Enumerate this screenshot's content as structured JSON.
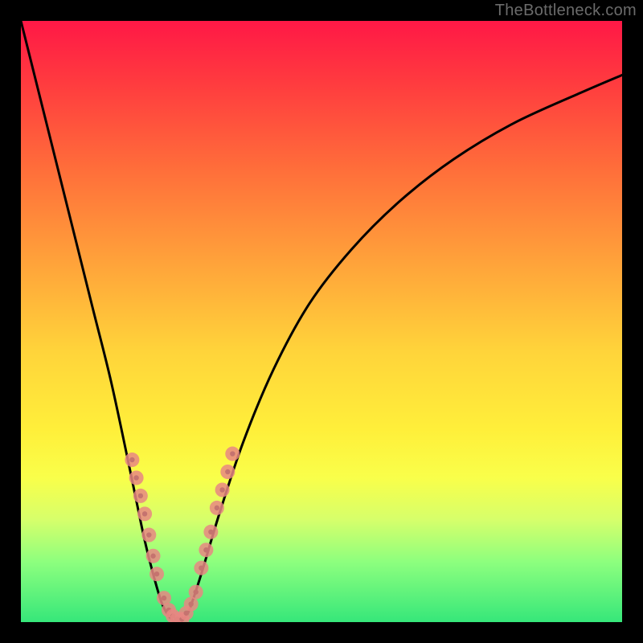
{
  "watermark": "TheBottleneck.com",
  "chart_data": {
    "type": "line",
    "title": "",
    "xlabel": "",
    "ylabel": "",
    "xlim": [
      0,
      100
    ],
    "ylim": [
      0,
      100
    ],
    "series": [
      {
        "name": "bottleneck-curve",
        "x": [
          0,
          3,
          6,
          9,
          12,
          15,
          18,
          20.5,
          22,
          23.5,
          25,
          26,
          27,
          28,
          30,
          33,
          37,
          42,
          48,
          55,
          63,
          72,
          82,
          93,
          100
        ],
        "y": [
          100,
          88,
          76,
          64,
          52,
          40,
          26,
          14,
          8,
          3,
          0.5,
          0,
          0.5,
          2,
          8,
          18,
          30,
          42,
          53,
          62,
          70,
          77,
          83,
          88,
          91
        ]
      }
    ],
    "markers": {
      "name": "highlight-cluster",
      "color": "#e88783",
      "points": [
        {
          "x": 18.5,
          "y": 27
        },
        {
          "x": 19.2,
          "y": 24
        },
        {
          "x": 19.9,
          "y": 21
        },
        {
          "x": 20.6,
          "y": 18
        },
        {
          "x": 21.3,
          "y": 14.5
        },
        {
          "x": 22.0,
          "y": 11
        },
        {
          "x": 22.6,
          "y": 8
        },
        {
          "x": 23.8,
          "y": 4
        },
        {
          "x": 24.6,
          "y": 2
        },
        {
          "x": 25.3,
          "y": 1
        },
        {
          "x": 26.0,
          "y": 0.5
        },
        {
          "x": 26.8,
          "y": 0.5
        },
        {
          "x": 27.5,
          "y": 1.5
        },
        {
          "x": 28.3,
          "y": 3
        },
        {
          "x": 29.1,
          "y": 5
        },
        {
          "x": 30.0,
          "y": 9
        },
        {
          "x": 30.8,
          "y": 12
        },
        {
          "x": 31.6,
          "y": 15
        },
        {
          "x": 32.6,
          "y": 19
        },
        {
          "x": 33.5,
          "y": 22
        },
        {
          "x": 34.4,
          "y": 25
        },
        {
          "x": 35.2,
          "y": 28
        }
      ]
    },
    "gradient_stops": [
      {
        "pos": 0,
        "color": "#ff1846"
      },
      {
        "pos": 25,
        "color": "#ff6f3a"
      },
      {
        "pos": 55,
        "color": "#ffd43a"
      },
      {
        "pos": 76,
        "color": "#f9ff4a"
      },
      {
        "pos": 100,
        "color": "#36e77a"
      }
    ]
  }
}
